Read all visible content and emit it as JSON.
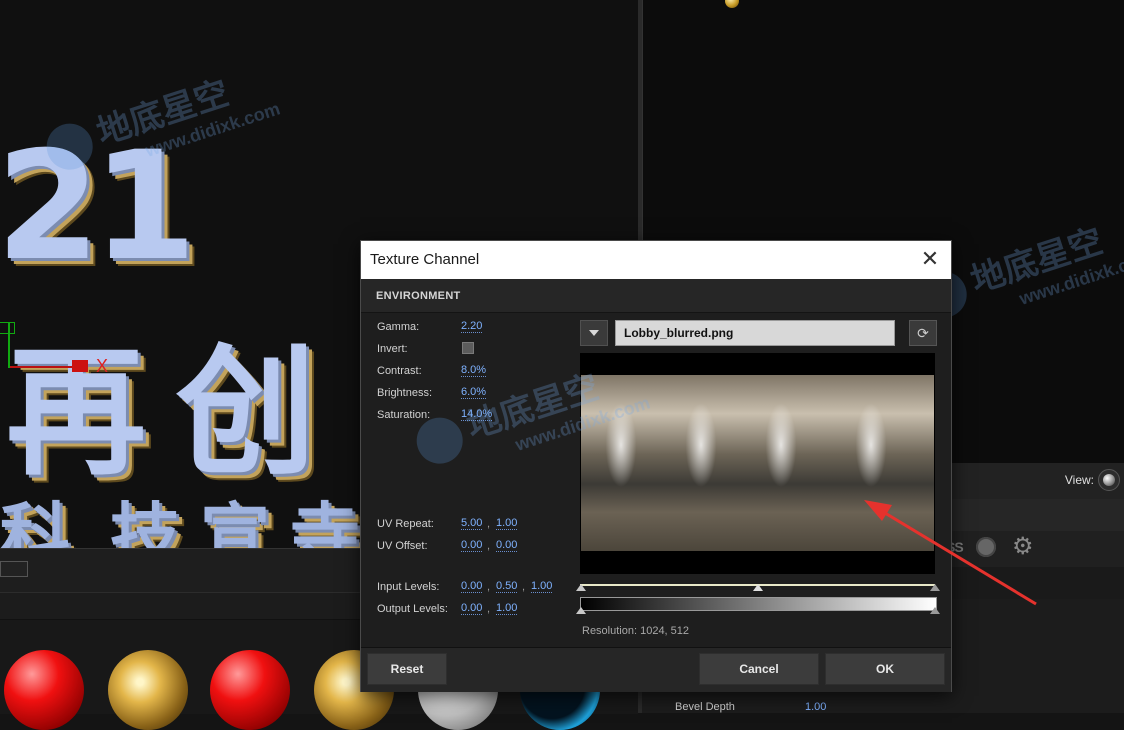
{
  "dialog": {
    "title": "Texture Channel",
    "section": "ENVIRONMENT",
    "gamma": {
      "label": "Gamma:",
      "value": "2.20"
    },
    "invert": {
      "label": "Invert:",
      "checked": false
    },
    "contrast": {
      "label": "Contrast:",
      "value": "8.0%"
    },
    "brightness": {
      "label": "Brightness:",
      "value": "6.0%"
    },
    "saturation": {
      "label": "Saturation:",
      "value": "14.0%"
    },
    "uv_repeat": {
      "label": "UV Repeat:",
      "u": "5.00",
      "v": "1.00"
    },
    "uv_offset": {
      "label": "UV Offset:",
      "u": "0.00",
      "v": "0.00"
    },
    "input_levels": {
      "label": "Input Levels:",
      "low": "0.00",
      "mid": "0.50",
      "high": "1.00"
    },
    "output_levels": {
      "label": "Output Levels:",
      "low": "0.00",
      "high": "1.00"
    },
    "separator": ",",
    "file_name": "Lobby_blurred.png",
    "resolution": "Resolution: 1024, 512",
    "buttons": {
      "reset": "Reset",
      "cancel": "Cancel",
      "ok": "OK"
    }
  },
  "background": {
    "view_label": "View:",
    "bevel_depth_label": "Bevel Depth",
    "bevel_depth_value": "1.00",
    "gizmo_axis": "X",
    "viewport_text": {
      "number": "21",
      "line1_a": "再",
      "line1_b": "创",
      "line2": [
        "科",
        "技",
        "宣",
        "寺"
      ]
    },
    "effects_text": "SS"
  },
  "watermark": {
    "cn": "地底星空",
    "url": "www.didixk.com"
  },
  "colors": {
    "accent_value": "#7fb2ff",
    "arrow": "#e5322d",
    "dialog_bg": "#1e1e1e"
  },
  "icons": [
    "close-icon",
    "chevron-down-icon",
    "refresh-icon",
    "globe-icon",
    "gear-icon"
  ]
}
